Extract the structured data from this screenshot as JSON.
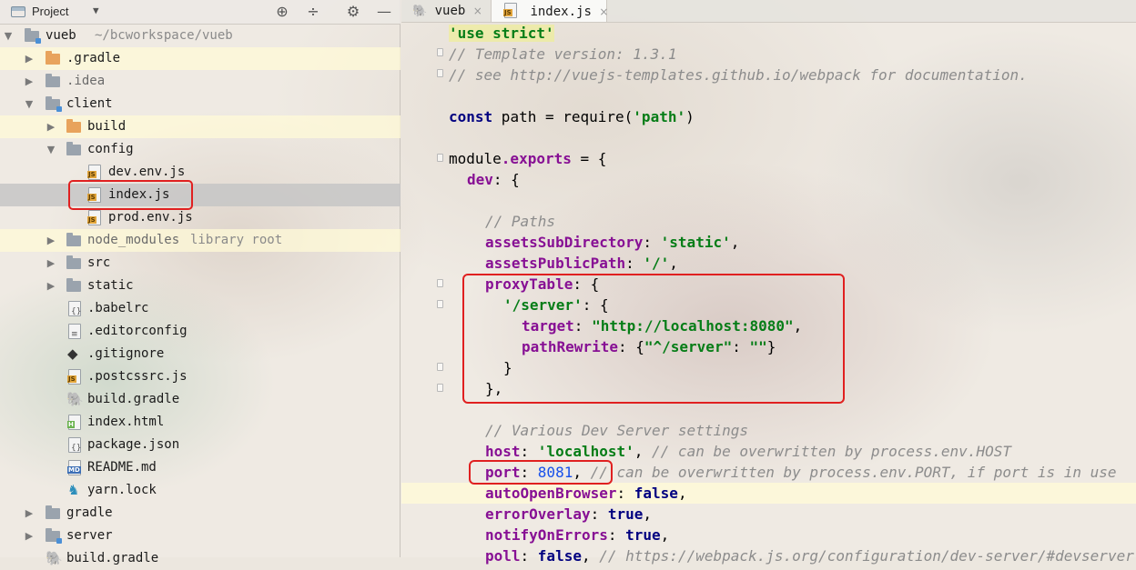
{
  "project_panel": {
    "title": "Project",
    "dropdown": "▼",
    "tools": [
      "target-icon",
      "collapse-icon",
      "gear-icon",
      "minimize-icon"
    ],
    "tree": [
      {
        "label": "vueb",
        "sublabel": "~/bcworkspace/vueb",
        "icon": "module-folder-icon",
        "arrow": "▼"
      },
      {
        "label": ".gradle",
        "icon": "folder-icon",
        "arrow": "▶"
      },
      {
        "label": ".idea",
        "icon": "folder-icon",
        "arrow": "▶"
      },
      {
        "label": "client",
        "icon": "module-folder-icon",
        "arrow": "▼"
      },
      {
        "label": "build",
        "icon": "folder-icon",
        "arrow": "▶"
      },
      {
        "label": "config",
        "icon": "folder-icon",
        "arrow": "▼"
      },
      {
        "label": "dev.env.js",
        "icon": "js-file-icon"
      },
      {
        "label": "index.js",
        "icon": "js-file-icon"
      },
      {
        "label": "prod.env.js",
        "icon": "js-file-icon"
      },
      {
        "label": "node_modules",
        "sublabel": "library root",
        "icon": "folder-icon",
        "arrow": "▶"
      },
      {
        "label": "src",
        "icon": "folder-icon",
        "arrow": "▶"
      },
      {
        "label": "static",
        "icon": "folder-icon",
        "arrow": "▶"
      },
      {
        "label": ".babelrc",
        "icon": "config-file-icon"
      },
      {
        "label": ".editorconfig",
        "icon": "text-file-icon"
      },
      {
        "label": ".gitignore",
        "icon": "git-icon"
      },
      {
        "label": ".postcssrc.js",
        "icon": "js-file-icon"
      },
      {
        "label": "build.gradle",
        "icon": "gradle-icon"
      },
      {
        "label": "index.html",
        "icon": "html-file-icon"
      },
      {
        "label": "package.json",
        "icon": "json-file-icon"
      },
      {
        "label": "README.md",
        "icon": "markdown-file-icon"
      },
      {
        "label": "yarn.lock",
        "icon": "yarn-icon"
      },
      {
        "label": "gradle",
        "icon": "folder-icon",
        "arrow": "▶"
      },
      {
        "label": "server",
        "icon": "folder-icon",
        "arrow": "▶"
      },
      {
        "label": "build.gradle",
        "icon": "gradle-icon"
      }
    ]
  },
  "editor": {
    "tabs": [
      {
        "label": "vueb",
        "close": "×",
        "icon": "gradle-icon"
      },
      {
        "label": "index.js",
        "close": "×",
        "icon": "js-file-icon"
      }
    ],
    "lines": {
      "l1": "'use strict'",
      "l2": "// Template version: 1.3.1",
      "l3": "// see http://vuejs-templates.github.io/webpack for documentation.",
      "l5_kw": "const",
      "l5_a": " path = require(",
      "l5_str": "'path'",
      "l5_b": ")",
      "l7_a": "module",
      "l7_b": ".exports",
      "l7_c": " = {",
      "l8_prop": "dev",
      "l8_rest": ": {",
      "l10": "// Paths",
      "l11_prop": "assetsSubDirectory",
      "l11_colon": ": ",
      "l11_str": "'static'",
      "l11_end": ",",
      "l12_prop": "assetsPublicPath",
      "l12_colon": ": ",
      "l12_str": "'/'",
      "l12_end": ",",
      "l13_prop": "proxyTable",
      "l13_rest": ": {",
      "l14_str": "'/server'",
      "l14_rest": ": {",
      "l15_prop": "target",
      "l15_colon": ": ",
      "l15_str": "\"http://localhost:8080\"",
      "l15_end": ",",
      "l16_prop": "pathRewrite",
      "l16_a": ": {",
      "l16_str1": "\"^/server\"",
      "l16_b": ": ",
      "l16_str2": "\"\"",
      "l16_c": "}",
      "l17": "}",
      "l18": "},",
      "l20": "// Various Dev Server settings",
      "l21_prop": "host",
      "l21_colon": ": ",
      "l21_str": "'localhost'",
      "l21_end": ", ",
      "l21_cmt": "// can be overwritten by process.env.HOST",
      "l22_prop": "port",
      "l22_colon": ": ",
      "l22_num": "8081",
      "l22_end": ", ",
      "l22_cmt": "// can be overwritten by process.env.PORT, if port is in use",
      "l23_prop": "autoOpenBrowser",
      "l23_colon": ": ",
      "l23_kw": "false",
      "l23_end": ",",
      "l24_prop": "errorOverlay",
      "l24_colon": ": ",
      "l24_kw": "true",
      "l24_end": ",",
      "l25_prop": "notifyOnErrors",
      "l25_colon": ": ",
      "l25_kw": "true",
      "l25_end": ",",
      "l26_prop": "poll",
      "l26_colon": ": ",
      "l26_kw": "false",
      "l26_end": ", ",
      "l26_cmt": "// https://webpack.js.org/configuration/dev-server/#devserver"
    }
  }
}
